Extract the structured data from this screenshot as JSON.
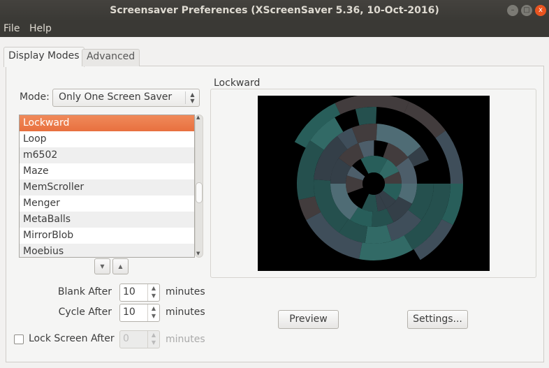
{
  "window": {
    "title": "Screensaver Preferences  (XScreenSaver 5.36, 10-Oct-2016)",
    "controls": [
      "minimize-icon",
      "maximize-icon",
      "close-icon"
    ]
  },
  "menu": [
    "File",
    "Help"
  ],
  "tabs": [
    {
      "label": "Display Modes",
      "active": true
    },
    {
      "label": "Advanced",
      "active": false
    }
  ],
  "mode": {
    "label": "Mode:",
    "value": "Only One Screen Saver"
  },
  "list": {
    "items": [
      "Lockward",
      "Loop",
      "m6502",
      "Maze",
      "MemScroller",
      "Menger",
      "MetaBalls",
      "MirrorBlob",
      "Moebius"
    ],
    "selected": "Lockward"
  },
  "blank": {
    "label": "Blank After",
    "value": "10",
    "unit": "minutes"
  },
  "cycle": {
    "label": "Cycle After",
    "value": "10",
    "unit": "minutes"
  },
  "lock": {
    "label": "Lock Screen After",
    "value": "0",
    "unit": "minutes",
    "checked": false
  },
  "preview": {
    "title": "Lockward",
    "preview_button": "Preview",
    "settings_button": "Settings..."
  },
  "colors": {
    "selection": "#e9733f",
    "titlebar": "#3c3b37",
    "close": "#e95420"
  }
}
